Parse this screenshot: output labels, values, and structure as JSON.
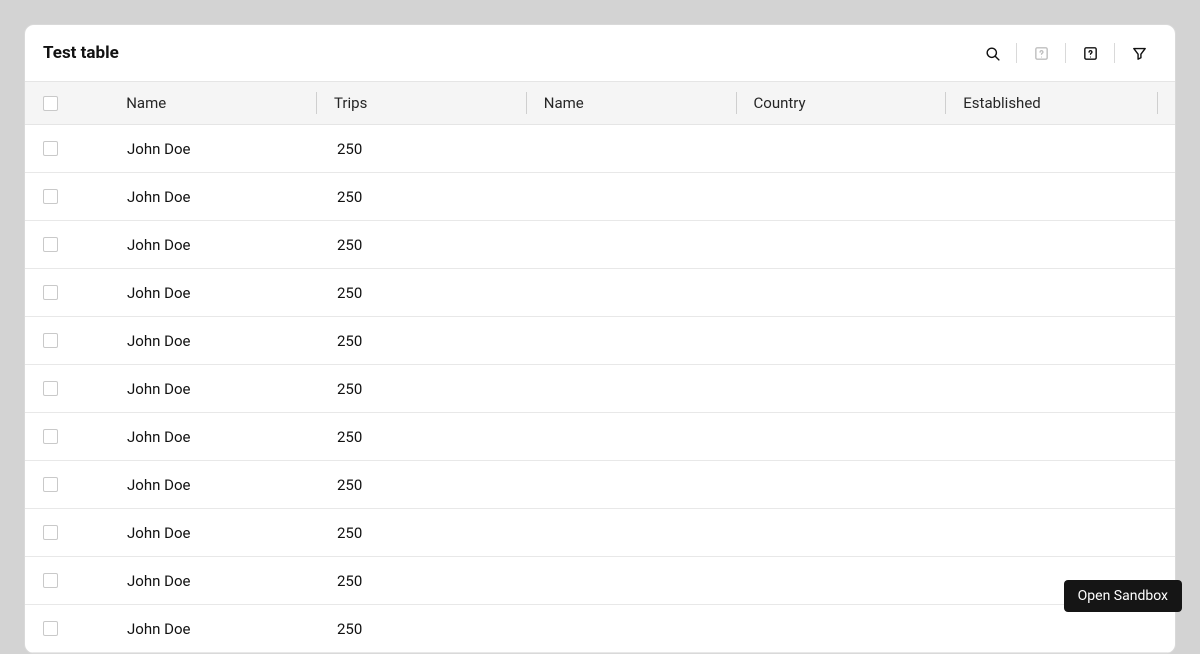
{
  "header": {
    "title": "Test table"
  },
  "columns": {
    "name": "Name",
    "trips": "Trips",
    "name2": "Name",
    "country": "Country",
    "established": "Established"
  },
  "rows": [
    {
      "name": "John Doe",
      "trips": "250"
    },
    {
      "name": "John Doe",
      "trips": "250"
    },
    {
      "name": "John Doe",
      "trips": "250"
    },
    {
      "name": "John Doe",
      "trips": "250"
    },
    {
      "name": "John Doe",
      "trips": "250"
    },
    {
      "name": "John Doe",
      "trips": "250"
    },
    {
      "name": "John Doe",
      "trips": "250"
    },
    {
      "name": "John Doe",
      "trips": "250"
    },
    {
      "name": "John Doe",
      "trips": "250"
    },
    {
      "name": "John Doe",
      "trips": "250"
    },
    {
      "name": "John Doe",
      "trips": "250"
    }
  ],
  "sandbox": {
    "label": "Open Sandbox"
  }
}
